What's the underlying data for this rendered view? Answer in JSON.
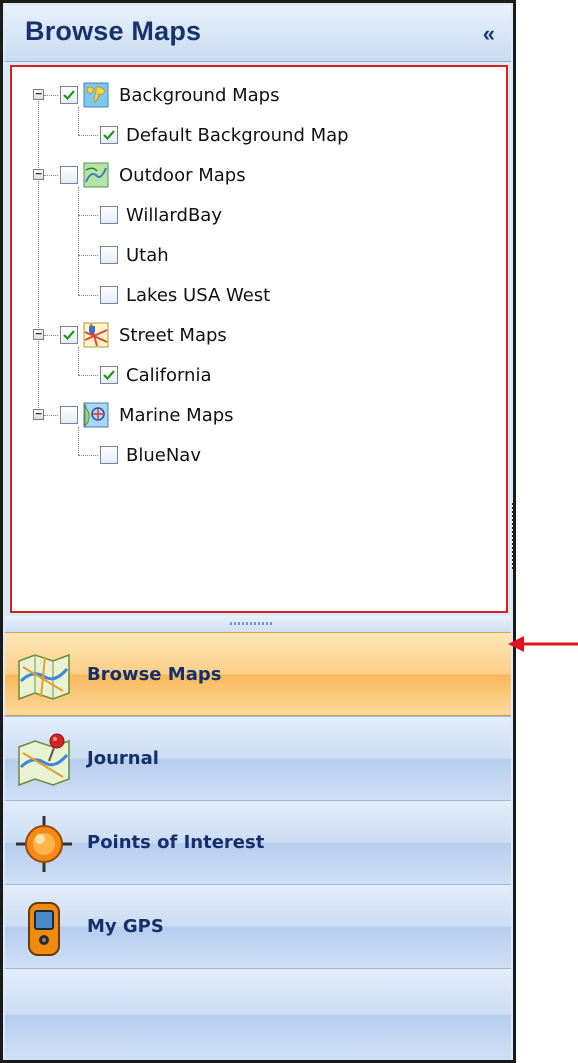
{
  "header": {
    "title": "Browse Maps",
    "collapse_glyph": "«"
  },
  "tree": [
    {
      "label": "Background Maps",
      "checked": true,
      "icon": "world-map-icon",
      "children": [
        {
          "label": "Default Background Map",
          "checked": true
        }
      ]
    },
    {
      "label": "Outdoor Maps",
      "checked": false,
      "icon": "topo-map-icon",
      "children": [
        {
          "label": "WillardBay",
          "checked": false
        },
        {
          "label": "Utah",
          "checked": false
        },
        {
          "label": "Lakes USA West",
          "checked": false
        }
      ]
    },
    {
      "label": "Street Maps",
      "checked": true,
      "icon": "street-map-icon",
      "children": [
        {
          "label": "California",
          "checked": true
        }
      ]
    },
    {
      "label": "Marine Maps",
      "checked": false,
      "icon": "marine-chart-icon",
      "children": [
        {
          "label": "BlueNav",
          "checked": false
        }
      ]
    }
  ],
  "nav": [
    {
      "label": "Browse Maps",
      "icon": "folded-map-icon",
      "active": true
    },
    {
      "label": "Journal",
      "icon": "journal-map-pin-icon",
      "active": false
    },
    {
      "label": "Points of Interest",
      "icon": "orange-target-icon",
      "active": false
    },
    {
      "label": "My GPS",
      "icon": "handheld-gps-icon",
      "active": false
    }
  ],
  "colors": {
    "accent_active": "#f8b95c",
    "header_text": "#16336e",
    "highlight_border": "#d42020",
    "arrow": "#e0141e"
  }
}
